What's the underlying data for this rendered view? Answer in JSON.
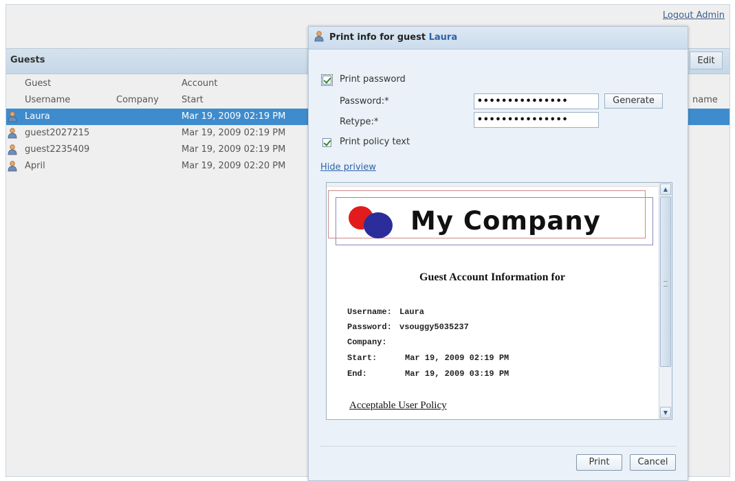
{
  "header": {
    "logout_label": "Logout Admin"
  },
  "guests": {
    "title": "Guests",
    "edit_label": "Edit",
    "group_headers": {
      "guest": "Guest",
      "account": "Account"
    },
    "columns": {
      "username": "Username",
      "company": "Company",
      "start": "Start",
      "name_partial": "name"
    },
    "rows": [
      {
        "username": "Laura",
        "company": "",
        "start": "Mar 19, 2009 02:19 PM",
        "selected": true
      },
      {
        "username": "guest2027215",
        "company": "",
        "start": "Mar 19, 2009 02:19 PM",
        "selected": false
      },
      {
        "username": "guest2235409",
        "company": "",
        "start": "Mar 19, 2009 02:19 PM",
        "selected": false
      },
      {
        "username": "April",
        "company": "",
        "start": "Mar 19, 2009 02:20 PM",
        "selected": false
      }
    ]
  },
  "dialog": {
    "title_prefix": "Print info for guest",
    "guest_name": "Laura",
    "print_password_label": "Print password",
    "print_password_checked": true,
    "password_label": "Password:*",
    "password_value": "•••••••••••••••",
    "retype_label": "Retype:*",
    "retype_value": "•••••••••••••••",
    "generate_label": "Generate",
    "print_policy_label": "Print policy text",
    "print_policy_checked": true,
    "hide_preview_label": "Hide priview",
    "print_label": "Print",
    "cancel_label": "Cancel"
  },
  "preview": {
    "company_logo_text": "My Company",
    "heading": "Guest Account Information for",
    "fields": [
      {
        "label": "Username:",
        "value": "Laura"
      },
      {
        "label": "Password:",
        "value": "vsouggy5035237"
      },
      {
        "label": "Company:",
        "value": ""
      },
      {
        "label": "Start:",
        "value": "Mar 19, 2009 02:19 PM"
      },
      {
        "label": "End:",
        "value": "Mar 19, 2009 03:19 PM"
      }
    ],
    "policy_link": "Acceptable User Policy"
  },
  "colors": {
    "selection": "#3e8ccd",
    "link": "#2e63a8",
    "logo_red": "#e21c1c",
    "logo_blue": "#2b2d9b"
  },
  "icons": {
    "guest": "user-icon"
  }
}
